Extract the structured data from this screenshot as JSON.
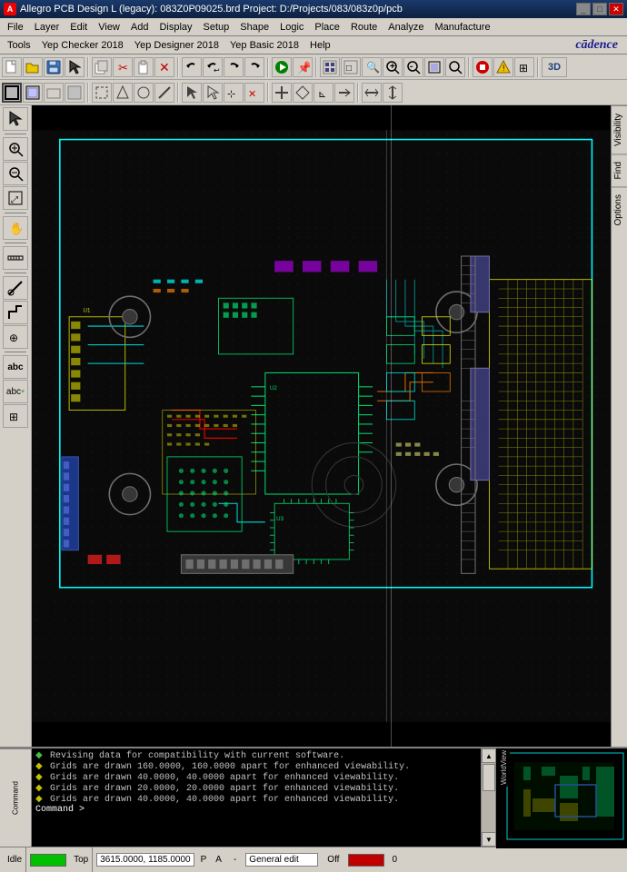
{
  "window": {
    "title": "Allegro PCB Design L (legacy): 083Z0P09025.brd  Project: D:/Projects/083/083z0p/pcb",
    "icon": "A"
  },
  "menubar1": {
    "items": [
      "File",
      "Layer",
      "Edit",
      "View",
      "Add",
      "Display",
      "Setup",
      "Shape",
      "Logic",
      "Place",
      "Route",
      "Analyze",
      "Manufacture"
    ]
  },
  "menubar2": {
    "items": [
      "Tools",
      "Yep Checker 2018",
      "Yep Designer 2018",
      "Yep Basic 2018",
      "Help"
    ],
    "cadence": "cādence"
  },
  "statusbar": {
    "status": "Idle",
    "mode": "Top",
    "coords": "3615.0000, 1185.0000",
    "p_flag": "P",
    "a_flag": "A",
    "dash": "-",
    "general_edit": "General edit",
    "off": "Off",
    "number": "0"
  },
  "console": {
    "lines": [
      {
        "marker": "◆",
        "type": "diamond",
        "text": "Revising data for compatibility with current software."
      },
      {
        "marker": "◆",
        "type": "arrow",
        "text": "Grids are drawn 160.0000, 160.0000 apart for enhanced viewability."
      },
      {
        "marker": "◆",
        "type": "arrow",
        "text": "Grids are drawn 40.0000, 40.0000 apart for enhanced viewability."
      },
      {
        "marker": "◆",
        "type": "arrow",
        "text": "Grids are drawn 20.0000, 20.0000 apart for enhanced viewability."
      },
      {
        "marker": "◆",
        "type": "arrow",
        "text": "Grids are drawn 40.0000, 40.0000 apart for enhanced viewability."
      },
      {
        "marker": "",
        "type": "prompt",
        "text": "Command >"
      }
    ]
  },
  "right_panel": {
    "tabs": [
      "Visibility",
      "Find",
      "Options"
    ]
  },
  "left_toolbar": {
    "buttons": [
      {
        "icon": "↖",
        "name": "select"
      },
      {
        "icon": "⊕",
        "name": "zoom-in"
      },
      {
        "icon": "⊖",
        "name": "zoom-out"
      },
      {
        "icon": "⤢",
        "name": "zoom-fit"
      },
      {
        "icon": "✋",
        "name": "pan"
      },
      {
        "icon": "⬚",
        "name": "rect"
      },
      {
        "icon": "◯",
        "name": "circle"
      },
      {
        "icon": "∿",
        "name": "arc"
      },
      {
        "icon": "⬡",
        "name": "polygon"
      },
      {
        "icon": "✒",
        "name": "text"
      },
      {
        "icon": "abc",
        "name": "text2"
      },
      {
        "icon": "abc+",
        "name": "text3"
      }
    ]
  }
}
